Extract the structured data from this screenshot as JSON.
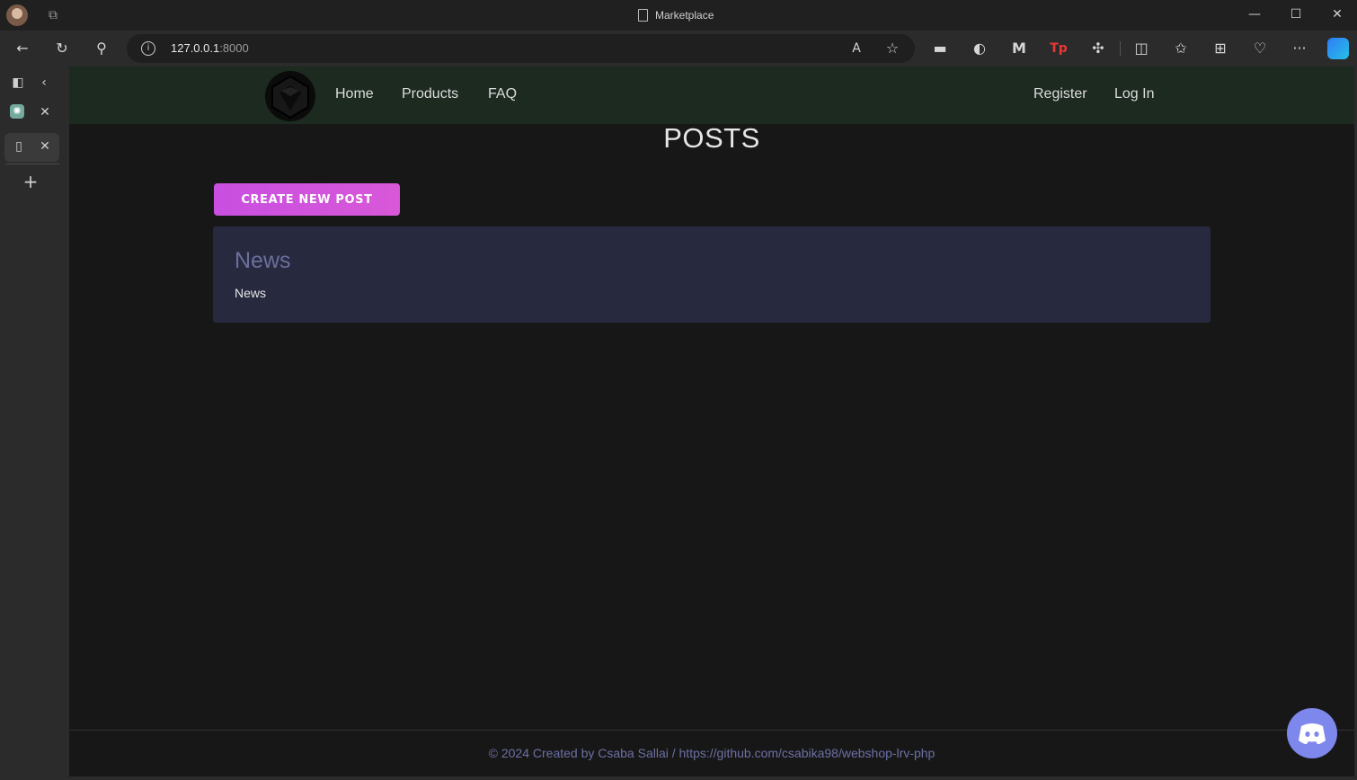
{
  "window": {
    "title": "Marketplace",
    "minimize_icon": "minimize-icon",
    "maximize_icon": "maximize-icon",
    "close_icon": "close-icon"
  },
  "browser": {
    "url_host": "127.0.0.1",
    "url_port": ":8000",
    "toolbar_icons": [
      "back-icon",
      "refresh-icon",
      "search-icon",
      "read-aloud-icon",
      "favorite-star-icon",
      "extension-icon",
      "extension-icon",
      "malwarebytes-icon",
      "tp-extension-icon",
      "extensions-puzzle-icon",
      "split-screen-icon",
      "favorites-icon",
      "collections-icon",
      "browser-health-icon",
      "more-icon",
      "copilot-icon"
    ]
  },
  "sidebar": {
    "tabs": [
      {
        "name": "chatgpt-tab"
      },
      {
        "name": "marketplace-tab"
      }
    ]
  },
  "site": {
    "nav": {
      "links": [
        "Home",
        "Products",
        "FAQ"
      ],
      "auth": [
        "Register",
        "Log In"
      ]
    },
    "page_title": "POSTS",
    "create_button": "CREATE NEW POST",
    "posts": [
      {
        "title": "News",
        "body": "News"
      }
    ],
    "footer": "© 2024 Created by Csaba Sallai / https://github.com/csabika98/webshop-lrv-php"
  },
  "colors": {
    "nav_bg": "#1c2a20",
    "page_bg": "#171717",
    "card_bg": "#272a3f",
    "accent": "#d056de",
    "discord": "#7e87ec"
  }
}
